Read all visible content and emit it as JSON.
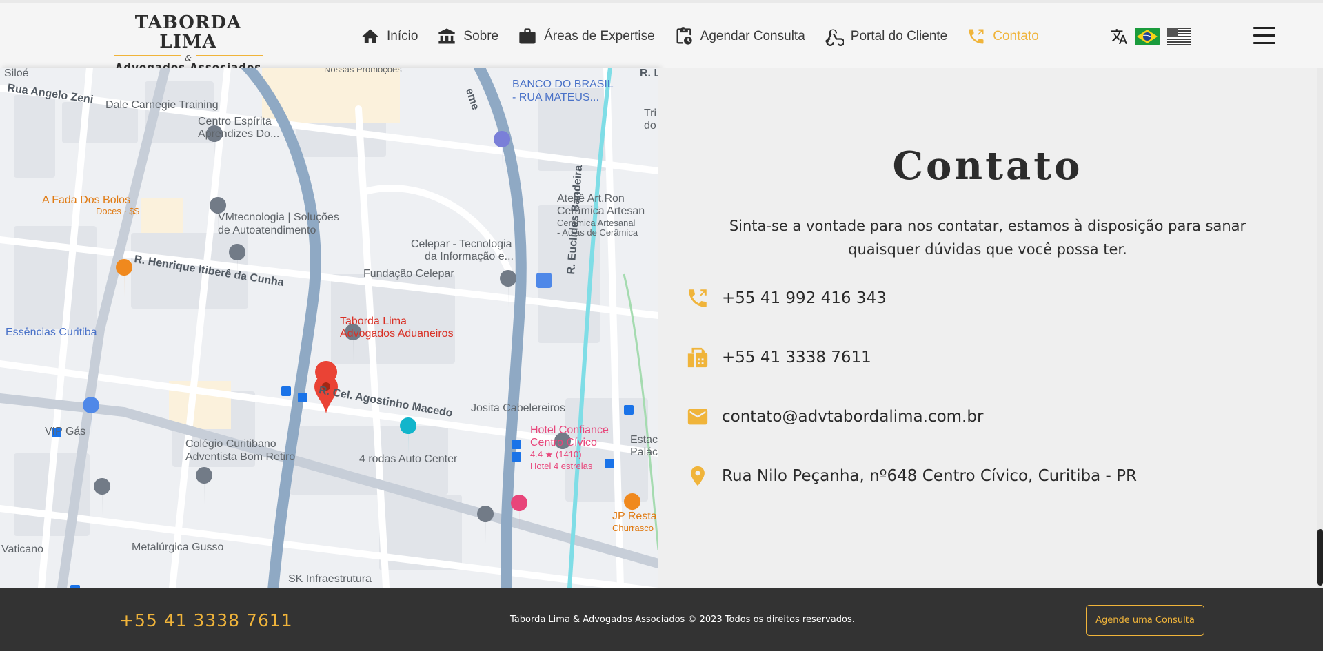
{
  "header": {
    "logo": {
      "line1": "TABORDA LIMA",
      "amp": "&",
      "line2": "Advogados Associados"
    },
    "nav": [
      {
        "label": "Início",
        "icon": "home-icon"
      },
      {
        "label": "Sobre",
        "icon": "building-icon"
      },
      {
        "label": "Áreas de Expertise",
        "icon": "briefcase-icon"
      },
      {
        "label": "Agendar Consulta",
        "icon": "clipboard-clock-icon"
      },
      {
        "label": "Portal do Cliente",
        "icon": "webhook-icon"
      },
      {
        "label": "Contato",
        "icon": "phone-icon",
        "active": true
      }
    ],
    "languages": [
      "translate-icon",
      "brazil-flag",
      "usa-flag"
    ]
  },
  "map": {
    "labels": {
      "siloe": "Siloé",
      "nossas": "Nossas Promoções",
      "rua_angelo": "Rua Angelo Zeni",
      "dale": "Dale Carnegie Training",
      "banco1": "BANCO DO BRASIL",
      "banco2": "- RUA MATEUS...",
      "centro1": "Centro Espírita",
      "centro2": "Aprendizes Do...",
      "fada": "A Fada Dos Bolos",
      "doces": "Doces · $$",
      "vm1": "VMtecnologia | Soluções",
      "vm2": "de Autoatendimento",
      "atelie1": "Ateliê Art.Ron",
      "atelie2": "Cerâmica Artesan",
      "atelie3": "Cerâmica Artesanal",
      "atelie4": "- Aulas de Cerâmica",
      "celepar1": "Celepar - Tecnologia",
      "celepar2": "da Informação e...",
      "henrique": "R. Henrique Itiberê da Cunha",
      "fundacao": "Fundação Celepar",
      "taborda1": "Taborda Lima",
      "taborda2": "Advogados Aduaneiros",
      "essencias": "Essências Curitiba",
      "euclides": "R. Euclides Bandeira",
      "agostinho": "R. Cel. Agostinho Macedo",
      "josita": "Josita Cabelereiros",
      "hotel1": "Hotel Confiance",
      "hotel2": "Centro Cívico",
      "hotel3": "4.4 ★ (1410)",
      "hotel4": "Hotel 4 estrelas",
      "vip": "VIP Gás",
      "colegio1": "Colégio Curitibano",
      "colegio2": "Adventista Bom Retiro",
      "rodas": "4 rodas Auto Center",
      "estac1": "Estac",
      "estac2": "Paláci",
      "jp1": "JP Resta",
      "jp2": "Churrasco",
      "vaticano": "Vaticano",
      "metalurgica": "Metalúrgica Gusso",
      "sk": "SK Infraestrutura",
      "rl": "R. L",
      "tri": "Tri",
      "do": "do",
      "eme": "eme"
    }
  },
  "contact": {
    "title": "Contato",
    "subtitle": "Sinta-se a vontade para nos contatar, estamos à disposição para sanar quaisquer dúvidas que você possa ter.",
    "phone": "+55 41 992 416 343",
    "fax": "+55 41 3338 7611",
    "email": "contato@advtabordalima.com.br",
    "address": "Rua Nilo Peçanha, nº648 Centro Cívico, Curitiba - PR"
  },
  "footer": {
    "phone": "+55 41 3338 7611",
    "copyright": "Taborda Lima & Advogados Associados © 2023 Todos os direitos reservados.",
    "cta": "Agende uma Consulta"
  },
  "colors": {
    "accent": "#f0b43a",
    "footer_bg": "#333333",
    "text": "#2c2c2c"
  }
}
